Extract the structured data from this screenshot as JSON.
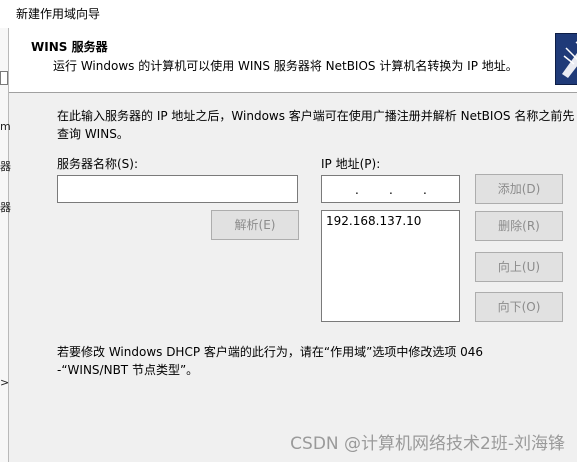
{
  "window": {
    "title": "新建作用域向导"
  },
  "side_fragments": [
    "m",
    "器",
    "器",
    ">"
  ],
  "header": {
    "title": "WINS 服务器",
    "subtitle": "运行 Windows 的计算机可以使用 WINS 服务器将 NetBIOS 计算机名转换为 IP 地址。",
    "icon": "wizard-icon"
  },
  "main": {
    "description": "在此输入服务器的 IP 地址之后，Windows 客户端可在使用广播注册并解析 NetBIOS 名称之前先查询 WINS。",
    "server_name_label": "服务器名称(S):",
    "server_name_value": "",
    "ip_label": "IP 地址(P):",
    "ip_value": ". . .",
    "resolve_button": "解析(E)",
    "ip_list": [
      "192.168.137.10"
    ],
    "buttons": {
      "add": "添加(D)",
      "remove": "删除(R)",
      "up": "向上(U)",
      "down": "向下(O)"
    },
    "note": "若要修改 Windows DHCP 客户端的此行为，请在“作用域”选项中修改选项 046 -“WINS/NBT 节点类型”。"
  },
  "watermark": "CSDN @计算机网络技术2班-刘海锋",
  "colors": {
    "header_bg": "#ffffff",
    "dialog_bg": "#f0f0f0",
    "icon_bg": "#1f3a78"
  }
}
